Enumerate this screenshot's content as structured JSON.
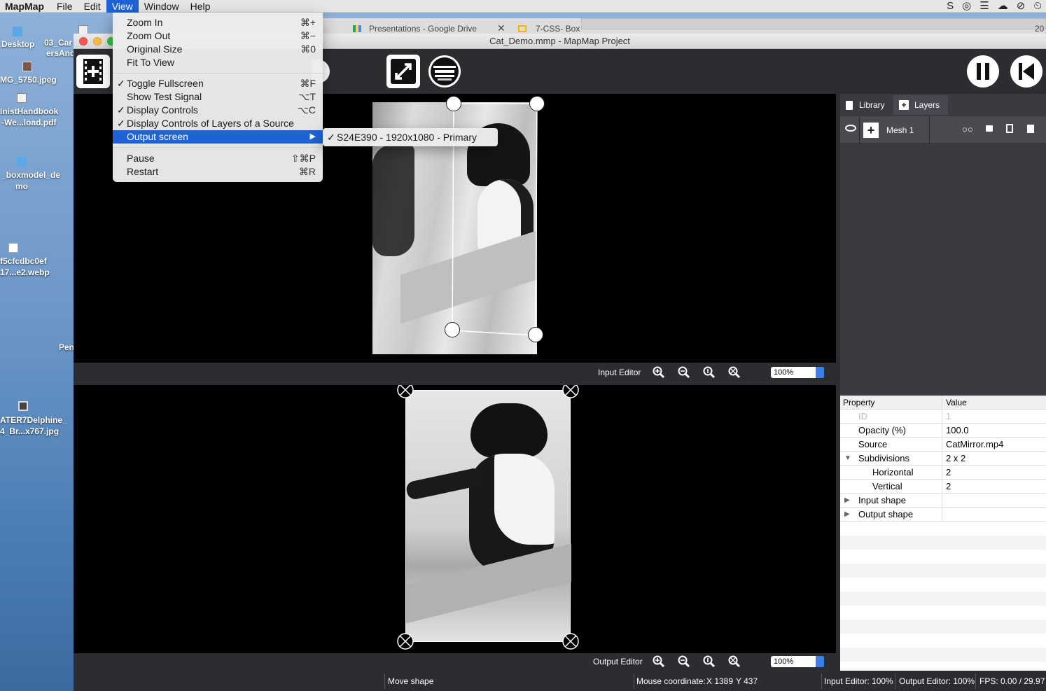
{
  "menubar": {
    "app": "MapMap",
    "items": [
      "File",
      "Edit",
      "View",
      "Window",
      "Help"
    ],
    "active": "View",
    "status_icons": [
      "S",
      "◎",
      "☰",
      "☁",
      "⊘",
      "⏲"
    ]
  },
  "desktop": {
    "items": [
      "Desktop",
      "03_Car",
      "ersAnd",
      "MG_5750.jpeg",
      "inistHandbook",
      "-We...load.pdf",
      "_boxmodel_de",
      "mo",
      "f5cfcdbc0ef",
      "17...e2.webp",
      "Pen",
      "ATER7Delphine_",
      "4_Br...x767.jpg"
    ]
  },
  "browser": {
    "tabs": [
      "Presentations - Google Drive",
      "7-CSS- Box"
    ],
    "right_text": "20"
  },
  "window": {
    "title": "Cat_Demo.mmp - MapMap Project"
  },
  "input_editor": {
    "label": "Input Editor",
    "zoom": "100%"
  },
  "output_editor": {
    "label": "Output Editor",
    "zoom": "100%"
  },
  "panel": {
    "tabs": [
      "Library",
      "Layers"
    ],
    "active_tab": "Layers",
    "layer": {
      "name": "Mesh 1"
    },
    "table": {
      "headers": [
        "Property",
        "Value"
      ],
      "rows": [
        {
          "key": "ID",
          "value": "1",
          "dim": true
        },
        {
          "key": "Opacity (%)",
          "value": "100.0"
        },
        {
          "key": "Source",
          "value": "CatMirror.mp4"
        },
        {
          "key": "Subdivisions",
          "value": "2 x 2",
          "expander": "▼"
        },
        {
          "key": "Horizontal",
          "value": "2",
          "indent": true
        },
        {
          "key": "Vertical",
          "value": "2",
          "indent": true
        },
        {
          "key": "Input shape",
          "value": "",
          "expander": "▶"
        },
        {
          "key": "Output shape",
          "value": "",
          "expander": "▶"
        }
      ]
    }
  },
  "status": {
    "action": "Move shape",
    "mouse_label": "Mouse coordinate:",
    "mouse_x": "X 1389",
    "mouse_y": "Y 437",
    "input_zoom": "Input Editor: 100%",
    "output_zoom": "Output Editor: 100%",
    "fps": "FPS: 0.00 / 29.97"
  },
  "view_menu": {
    "items": [
      {
        "label": "Zoom In",
        "shortcut": "⌘+"
      },
      {
        "label": "Zoom Out",
        "shortcut": "⌘−"
      },
      {
        "label": "Original Size",
        "shortcut": "⌘0"
      },
      {
        "label": "Fit To View",
        "shortcut": ""
      },
      {
        "label": "Toggle Fullscreen",
        "shortcut": "⌘F",
        "checked": true
      },
      {
        "label": "Show Test Signal",
        "shortcut": "⌥T"
      },
      {
        "label": "Display Controls",
        "shortcut": "⌥C",
        "checked": true
      },
      {
        "label": "Display Controls of Layers of a Source",
        "shortcut": "",
        "checked": true
      },
      {
        "label": "Output screen",
        "shortcut": "▶",
        "highlighted": true
      },
      {
        "label": "Pause",
        "shortcut": "⇧⌘P"
      },
      {
        "label": "Restart",
        "shortcut": "⌘R"
      }
    ],
    "submenu": {
      "label": "S24E390 - 1920x1080 - Primary",
      "checked": true
    }
  },
  "colors": {
    "accent": "#1d63d6",
    "panel": "#3a3b40",
    "window": "#2c2d31",
    "canvas": "#000000"
  }
}
